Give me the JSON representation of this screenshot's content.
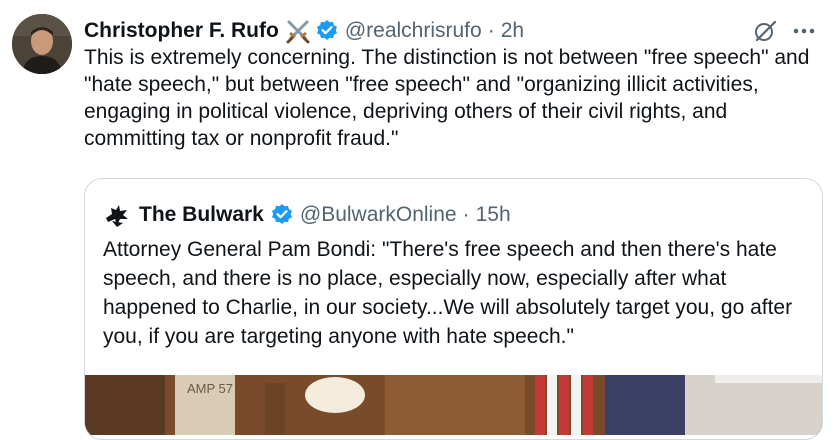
{
  "tweet": {
    "author": {
      "name": "Christopher F. Rufo",
      "handle": "@realchrisrufo",
      "separator": "·",
      "time": "2h",
      "emoji_icon": "crossed-swords-icon",
      "verified_icon": "verified-badge-icon",
      "verified_color": "#1d9bf0"
    },
    "text": "This is extremely concerning. The distinction is not between \"free speech\" and \"hate speech,\" but between \"free speech\" and \"organizing illicit activities, engaging in political violence, depriving others of their civil rights, and committing tax or nonprofit fraud.\"",
    "actions": {
      "grok_icon": "grok-icon",
      "more_icon": "more-horizontal-icon"
    },
    "quote": {
      "name": "The Bulwark",
      "handle": "@BulwarkOnline",
      "separator": "·",
      "time": "15h",
      "logo_icon": "bulwark-logo-icon",
      "verified_icon": "verified-badge-icon",
      "text": "Attorney General Pam Bondi: \"There's free speech and then there's hate speech, and there is no place, especially now, especially after what happened to Charlie, in our society...We will absolutely target you, go after you, if you are targeting anyone with hate speech.\"",
      "media_caption": "AMP 57"
    }
  }
}
